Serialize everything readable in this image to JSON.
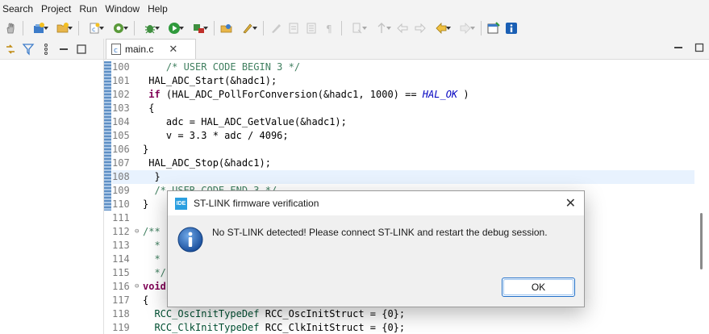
{
  "menu": [
    "Search",
    "Project",
    "Run",
    "Window",
    "Help"
  ],
  "left_panel": {
    "icons": [
      "link-icon",
      "filter-icon",
      "more-icon",
      "minimize-icon",
      "maximize-icon"
    ]
  },
  "editor": {
    "tab_label": "main.c",
    "tab_close": "✕",
    "lines": [
      {
        "n": "100",
        "fold": "",
        "parts": [
          [
            "cm",
            "    /* USER CODE BEGIN 3 */"
          ]
        ]
      },
      {
        "n": "101",
        "fold": "",
        "parts": [
          [
            "txt",
            " HAL_ADC_Start(&hadc1);"
          ]
        ]
      },
      {
        "n": "102",
        "fold": "",
        "parts": [
          [
            "kw",
            " if"
          ],
          [
            "txt",
            " (HAL_ADC_PollForConversion(&hadc1, 1000) == "
          ],
          [
            "it",
            "HAL_OK"
          ],
          [
            "txt",
            " )"
          ]
        ]
      },
      {
        "n": "103",
        "fold": "",
        "parts": [
          [
            "txt",
            " {"
          ]
        ]
      },
      {
        "n": "104",
        "fold": "",
        "parts": [
          [
            "txt",
            "    adc = HAL_ADC_GetValue(&hadc1);"
          ]
        ]
      },
      {
        "n": "105",
        "fold": "",
        "parts": [
          [
            "txt",
            "    v = 3.3 * adc / 4096;"
          ]
        ]
      },
      {
        "n": "106",
        "fold": "",
        "parts": [
          [
            "txt",
            "}"
          ]
        ]
      },
      {
        "n": "107",
        "fold": "",
        "parts": [
          [
            "txt",
            " HAL_ADC_Stop(&hadc1);"
          ]
        ]
      },
      {
        "n": "108",
        "fold": "",
        "parts": [
          [
            "txt",
            "  }"
          ]
        ],
        "current": true
      },
      {
        "n": "109",
        "fold": "",
        "parts": [
          [
            "cm",
            "  /* USER CODE END 3 */"
          ]
        ]
      },
      {
        "n": "110",
        "fold": "",
        "parts": [
          [
            "txt",
            "}"
          ]
        ]
      },
      {
        "n": "111",
        "fold": "",
        "parts": [
          [
            "txt",
            ""
          ]
        ]
      },
      {
        "n": "112",
        "fold": "⊖",
        "parts": [
          [
            "cm",
            "/**"
          ]
        ]
      },
      {
        "n": "113",
        "fold": "",
        "parts": [
          [
            "cm",
            "  *"
          ]
        ]
      },
      {
        "n": "114",
        "fold": "",
        "parts": [
          [
            "cm",
            "  *"
          ]
        ]
      },
      {
        "n": "115",
        "fold": "",
        "parts": [
          [
            "cm",
            "  */"
          ]
        ]
      },
      {
        "n": "116",
        "fold": "⊖",
        "parts": [
          [
            "kw",
            "void"
          ]
        ]
      },
      {
        "n": "117",
        "fold": "",
        "parts": [
          [
            "txt",
            "{"
          ]
        ]
      },
      {
        "n": "118",
        "fold": "",
        "parts": [
          [
            "ty",
            "  RCC_OscInitTypeDef"
          ],
          [
            "txt",
            " RCC_OscInitStruct = {0};"
          ]
        ]
      },
      {
        "n": "119",
        "fold": "",
        "parts": [
          [
            "ty",
            "  RCC_ClkInitTypeDef"
          ],
          [
            "txt",
            " RCC_ClkInitStruct = {0};"
          ]
        ]
      }
    ]
  },
  "dialog": {
    "badge": "IDE",
    "title": "ST-LINK firmware verification",
    "close": "✕",
    "message": "No ST-LINK detected! Please connect ST-LINK and restart the debug session.",
    "ok_label": "OK"
  },
  "colors": {
    "accent": "#1f6fc9",
    "info": "#1a5fb4",
    "keyword": "#7f0055",
    "comment": "#3f7f5f"
  }
}
